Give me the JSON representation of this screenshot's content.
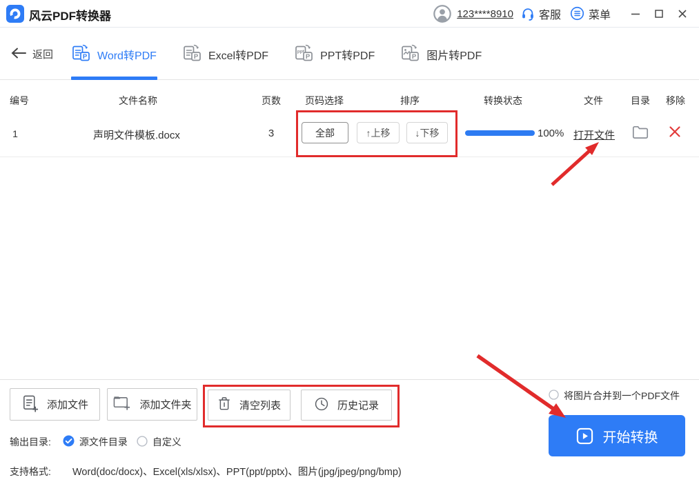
{
  "colors": {
    "accent_blue": "#2e7cf6",
    "annotation_red": "#e12b2b",
    "progress_blue": "#2d7bf2"
  },
  "titlebar": {
    "app_title": "风云PDF转换器",
    "account": "123****8910",
    "service_label": "客服",
    "menu_label": "菜单"
  },
  "nav": {
    "back_label": "返回",
    "tabs": [
      {
        "label": "Word转PDF",
        "active": true
      },
      {
        "label": "Excel转PDF",
        "active": false
      },
      {
        "label": "PPT转PDF",
        "active": false
      },
      {
        "label": "图片转PDF",
        "active": false
      }
    ]
  },
  "table": {
    "headers": [
      "编号",
      "文件名称",
      "页数",
      "页码选择",
      "排序",
      "转换状态",
      "文件",
      "目录",
      "移除"
    ],
    "row": {
      "index": "1",
      "filename": "声明文件模板.docx",
      "pages": "3",
      "select_all_label": "全部",
      "move_up_label": "↑上移",
      "move_down_label": "↓下移",
      "progress_percent": "100%",
      "open_file_label": "打开文件"
    }
  },
  "footer": {
    "add_file_label": "添加文件",
    "add_folder_label": "添加文件夹",
    "clear_list_label": "清空列表",
    "history_label": "历史记录",
    "merge_option_label": "将图片合并到一个PDF文件",
    "start_button_label": "开始转换",
    "output_dir_label": "输出目录:",
    "source_dir_label": "源文件目录",
    "custom_label": "自定义",
    "formats_label": "支持格式:",
    "formats_value": "Word(doc/docx)、Excel(xls/xlsx)、PPT(ppt/pptx)、图片(jpg/jpeg/png/bmp)"
  }
}
